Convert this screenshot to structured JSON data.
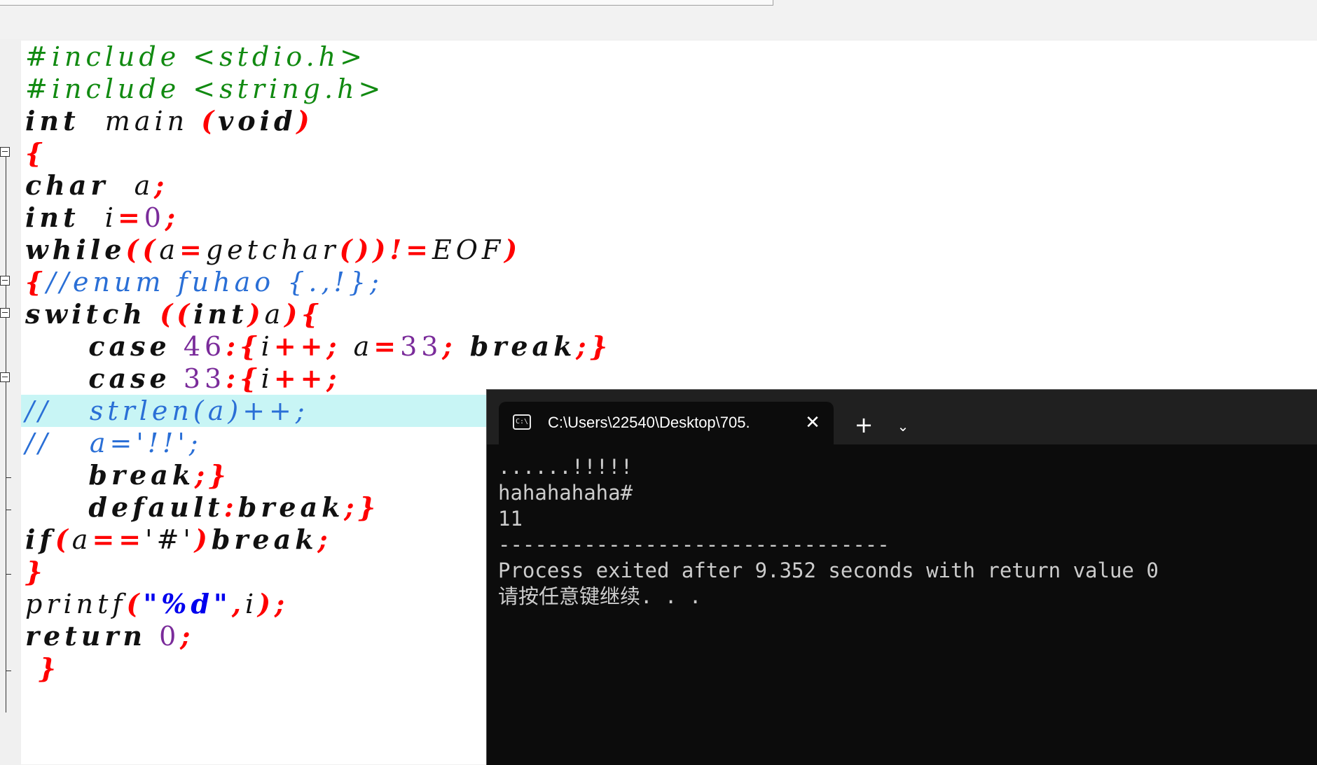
{
  "editor": {
    "lines": [
      [
        {
          "t": "#include <stdio.h>",
          "c": "pp"
        }
      ],
      [
        {
          "t": "#include <string.h>",
          "c": "pp"
        }
      ],
      [
        {
          "t": "int",
          "c": "kw"
        },
        {
          "t": "  main ",
          "c": "id"
        },
        {
          "t": "(",
          "c": "op"
        },
        {
          "t": "void",
          "c": "kw"
        },
        {
          "t": ")",
          "c": "op"
        }
      ],
      [
        {
          "t": "{",
          "c": "op"
        }
      ],
      [
        {
          "t": "char",
          "c": "kw"
        },
        {
          "t": "  a",
          "c": "id"
        },
        {
          "t": ";",
          "c": "op"
        }
      ],
      [
        {
          "t": "int",
          "c": "kw"
        },
        {
          "t": "  i",
          "c": "id"
        },
        {
          "t": "=",
          "c": "op"
        },
        {
          "t": "0",
          "c": "num"
        },
        {
          "t": ";",
          "c": "op"
        }
      ],
      [
        {
          "t": "while",
          "c": "kw"
        },
        {
          "t": "((",
          "c": "op"
        },
        {
          "t": "a",
          "c": "id"
        },
        {
          "t": "=",
          "c": "op"
        },
        {
          "t": "getchar",
          "c": "id"
        },
        {
          "t": "())!=",
          "c": "op"
        },
        {
          "t": "EOF",
          "c": "id"
        },
        {
          "t": ")",
          "c": "op"
        }
      ],
      [
        {
          "t": "{",
          "c": "op"
        },
        {
          "t": "//enum fuhao {.,!};",
          "c": "cm"
        }
      ],
      [
        {
          "t": "switch",
          "c": "kw"
        },
        {
          "t": " ((",
          "c": "op"
        },
        {
          "t": "int",
          "c": "kw"
        },
        {
          "t": ")",
          "c": "op"
        },
        {
          "t": "a",
          "c": "id"
        },
        {
          "t": "){",
          "c": "op"
        }
      ],
      [
        {
          "t": "     ",
          "c": "id"
        },
        {
          "t": "case",
          "c": "kw"
        },
        {
          "t": " ",
          "c": "id"
        },
        {
          "t": "46",
          "c": "num"
        },
        {
          "t": ":{",
          "c": "op"
        },
        {
          "t": "i",
          "c": "id"
        },
        {
          "t": "++;",
          "c": "op"
        },
        {
          "t": " a",
          "c": "id"
        },
        {
          "t": "=",
          "c": "op"
        },
        {
          "t": "33",
          "c": "num"
        },
        {
          "t": ";",
          "c": "op"
        },
        {
          "t": " break",
          "c": "kw"
        },
        {
          "t": ";}",
          "c": "op"
        }
      ],
      [
        {
          "t": "     ",
          "c": "id"
        },
        {
          "t": "case",
          "c": "kw"
        },
        {
          "t": " ",
          "c": "id"
        },
        {
          "t": "33",
          "c": "num"
        },
        {
          "t": ":{",
          "c": "op"
        },
        {
          "t": "i",
          "c": "id"
        },
        {
          "t": "++;",
          "c": "op"
        }
      ],
      [
        {
          "t": "//   strlen(a)++;",
          "c": "cm"
        }
      ],
      [
        {
          "t": "//   a='!!';",
          "c": "cm"
        }
      ],
      [
        {
          "t": "     ",
          "c": "id"
        },
        {
          "t": "break",
          "c": "kw"
        },
        {
          "t": ";}",
          "c": "op"
        }
      ],
      [
        {
          "t": "     ",
          "c": "id"
        },
        {
          "t": "default",
          "c": "kw"
        },
        {
          "t": ":",
          "c": "op"
        },
        {
          "t": "break",
          "c": "kw"
        },
        {
          "t": ";}",
          "c": "op"
        }
      ],
      [
        {
          "t": "if",
          "c": "kw"
        },
        {
          "t": "(",
          "c": "op"
        },
        {
          "t": "a",
          "c": "id"
        },
        {
          "t": "==",
          "c": "op"
        },
        {
          "t": "'#'",
          "c": "id"
        },
        {
          "t": ")",
          "c": "op"
        },
        {
          "t": "break",
          "c": "kw"
        },
        {
          "t": ";",
          "c": "op"
        }
      ],
      [
        {
          "t": "}",
          "c": "op"
        }
      ],
      [
        {
          "t": "printf",
          "c": "id"
        },
        {
          "t": "(",
          "c": "op"
        },
        {
          "t": "\"%d\"",
          "c": "str"
        },
        {
          "t": ",",
          "c": "op"
        },
        {
          "t": "i",
          "c": "id"
        },
        {
          "t": ");",
          "c": "op"
        }
      ],
      [
        {
          "t": "return",
          "c": "kw"
        },
        {
          "t": " ",
          "c": "id"
        },
        {
          "t": "0",
          "c": "num"
        },
        {
          "t": ";",
          "c": "op"
        }
      ],
      [
        {
          "t": " }",
          "c": "op"
        }
      ]
    ],
    "highlighted_line": 11
  },
  "console": {
    "tab_title": "C:\\Users\\22540\\Desktop\\705.",
    "tab_icon": "console-icon",
    "close_symbol": "✕",
    "add_symbol": "+",
    "dropdown_symbol": "⌄",
    "output": [
      "......!!!!!",
      "hahahahaha#",
      "11",
      "--------------------------------",
      "Process exited after 9.352 seconds with return value 0",
      "请按任意键继续. . ."
    ]
  }
}
